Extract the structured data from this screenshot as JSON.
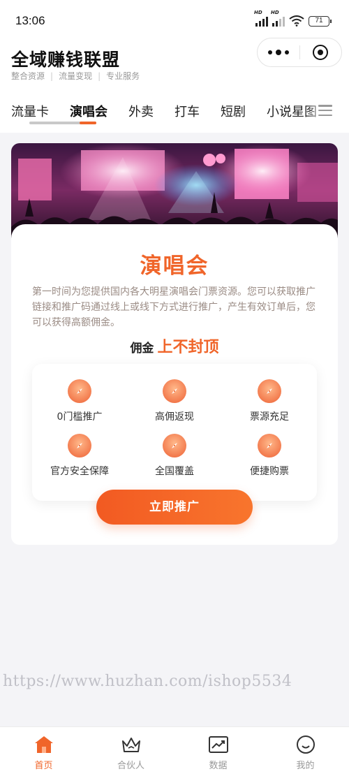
{
  "status_bar": {
    "time": "13:06",
    "battery": "71",
    "signal1_label": "HD",
    "signal2_label": "HD"
  },
  "header": {
    "title": "全域赚钱联盟",
    "subtitles": [
      "整合资源",
      "流量变现",
      "专业服务"
    ]
  },
  "tabs": [
    "流量卡",
    "演唱会",
    "外卖",
    "打车",
    "短剧",
    "小说星图"
  ],
  "active_tab_index": 1,
  "card": {
    "title": "演唱会",
    "description": "第一时间为您提供国内各大明星演唱会门票资源。您可以获取推广链接和推广码通过线上或线下方式进行推广，产生有效订单后，您可以获得高额佣金。",
    "commission_label": "佣金",
    "commission_highlight": "上不封顶",
    "features": [
      "0门槛推广",
      "高佣返现",
      "票源充足",
      "官方安全保障",
      "全国覆盖",
      "便捷购票"
    ],
    "cta_label": "立即推广"
  },
  "watermark": "https://www.huzhan.com/ishop5534",
  "bottom_nav": [
    {
      "label": "首页",
      "icon": "home-icon",
      "active": true
    },
    {
      "label": "合伙人",
      "icon": "crown-icon",
      "active": false
    },
    {
      "label": "数据",
      "icon": "chart-icon",
      "active": false
    },
    {
      "label": "我的",
      "icon": "smile-icon",
      "active": false
    }
  ],
  "colors": {
    "accent": "#f0652a",
    "muted_text": "#9a8b84"
  }
}
